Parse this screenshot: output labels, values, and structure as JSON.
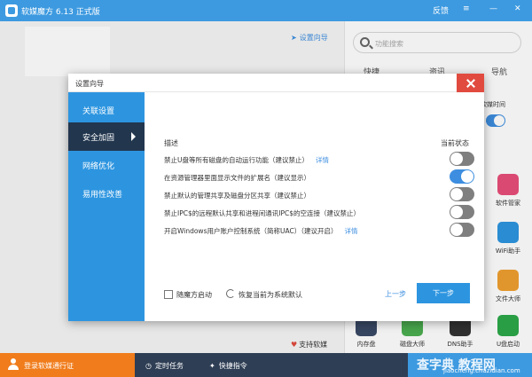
{
  "app": {
    "title": "软媒魔方 6.13 正式版",
    "feedback": "反馈",
    "menu": "≡",
    "minimize": "—",
    "close": "✕"
  },
  "main": {
    "guide_link": "设置向导",
    "search_placeholder": "功能搜索",
    "tabs": [
      "快捷",
      "资讯",
      "导航"
    ],
    "toggle_label": "软媒时间",
    "tools": [
      {
        "label": "软件管家",
        "color": "#e84e7a"
      },
      {
        "label": "WiFi助手",
        "color": "#2d95e0"
      },
      {
        "label": "文件大师",
        "color": "#f0a030"
      },
      {
        "label": "内存盘",
        "color": "#3a4a66"
      },
      {
        "label": "磁盘大师",
        "color": "#4caf50"
      },
      {
        "label": "DNS助手",
        "color": "#333333"
      },
      {
        "label": "U盘启动",
        "color": "#2ca84a"
      }
    ],
    "support": "支持软媒"
  },
  "bottombar": {
    "login": "登录软媒通行证",
    "scheduled": "定时任务",
    "quick_cmd": "快捷指令",
    "watermark": "查字典 教程网",
    "watermark_url": "jiaocheng.chazidian.com"
  },
  "dialog": {
    "title": "设置向导",
    "side": [
      "关联设置",
      "安全加固",
      "网络优化",
      "易用性改善"
    ],
    "col_desc": "描述",
    "col_state": "当前状态",
    "rows": [
      {
        "text": "禁止U盘等所有磁盘的自动运行功能（建议禁止）",
        "link": "详情",
        "on": false
      },
      {
        "text": "在资源管理器里面显示文件的扩展名（建议显示）",
        "link": "",
        "on": true
      },
      {
        "text": "禁止默认的管理共享及磁盘分区共享（建议禁止）",
        "link": "",
        "on": false
      },
      {
        "text": "禁止IPC$的远程默认共享和进程间通讯IPC$的空连接（建议禁止）",
        "link": "",
        "on": false
      },
      {
        "text": "开启Windows用户账户控制系统（简称UAC）（建议开启）",
        "link": "详情",
        "on": false
      }
    ],
    "startup_label": "随魔方启动",
    "restore_label": "恢复当前为系统默认",
    "prev": "上一步",
    "next": "下一步"
  }
}
